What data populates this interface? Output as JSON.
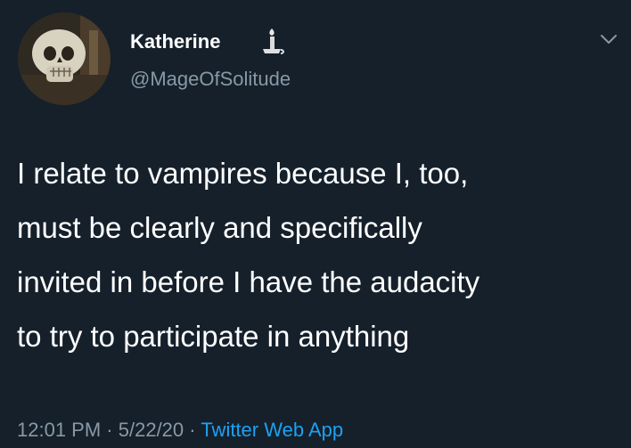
{
  "tweet": {
    "display_name": "Katherine",
    "handle": "@MageOfSolitude",
    "body_lines": [
      "I relate to vampires because I, too,",
      "must be clearly and specifically",
      "invited in before I have the audacity",
      "to try to participate in anything"
    ],
    "time": "12:01 PM",
    "separator": "·",
    "date": "5/22/20",
    "source": "Twitter Web App"
  },
  "icons": {
    "avatar": "skull-avatar",
    "name_emoji": "candle-emoji",
    "menu": "chevron-down-icon"
  },
  "colors": {
    "background": "#15202b",
    "primary_text": "#ffffff",
    "secondary_text": "#8899a6",
    "link": "#1da1f2"
  }
}
